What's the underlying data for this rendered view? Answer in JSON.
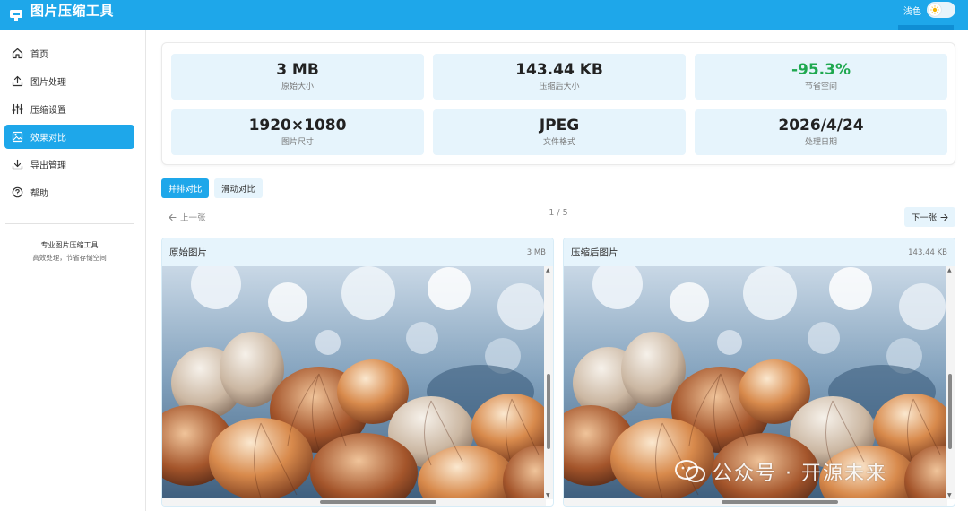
{
  "app": {
    "title": "图片压缩工具"
  },
  "header": {
    "theme_label": "浅色"
  },
  "sidebar": {
    "items": [
      {
        "label": "首页",
        "icon": "home-icon"
      },
      {
        "label": "图片处理",
        "icon": "upload-icon"
      },
      {
        "label": "压缩设置",
        "icon": "sliders-icon"
      },
      {
        "label": "效果对比",
        "icon": "image-compare-icon",
        "active": true
      },
      {
        "label": "导出管理",
        "icon": "download-icon"
      },
      {
        "label": "帮助",
        "icon": "help-icon"
      }
    ],
    "footer_title": "专业图片压缩工具",
    "footer_subtitle": "高效处理，节省存储空间"
  },
  "stats": [
    {
      "value": "3 MB",
      "label": "原始大小"
    },
    {
      "value": "143.44 KB",
      "label": "压缩后大小"
    },
    {
      "value": "-95.3%",
      "label": "节省空间"
    },
    {
      "value": "1920×1080",
      "label": "图片尺寸"
    },
    {
      "value": "JPEG",
      "label": "文件格式"
    },
    {
      "value": "2026/4/24",
      "label": "处理日期"
    }
  ],
  "compare": {
    "mode_side_by_side": "并排对比",
    "mode_slider": "滑动对比",
    "prev_label": "上一张",
    "next_label": "下一张",
    "page_indicator": "1 / 5"
  },
  "cards": [
    {
      "title": "原始图片",
      "size": "3 MB"
    },
    {
      "title": "压缩后图片",
      "size": "143.44 KB"
    }
  ],
  "watermark": {
    "text": "公众号 · 开源未来"
  },
  "colors": {
    "accent": "#1ea7ea",
    "stat_bg": "#e6f4fc",
    "savings": "#1fa84f"
  }
}
